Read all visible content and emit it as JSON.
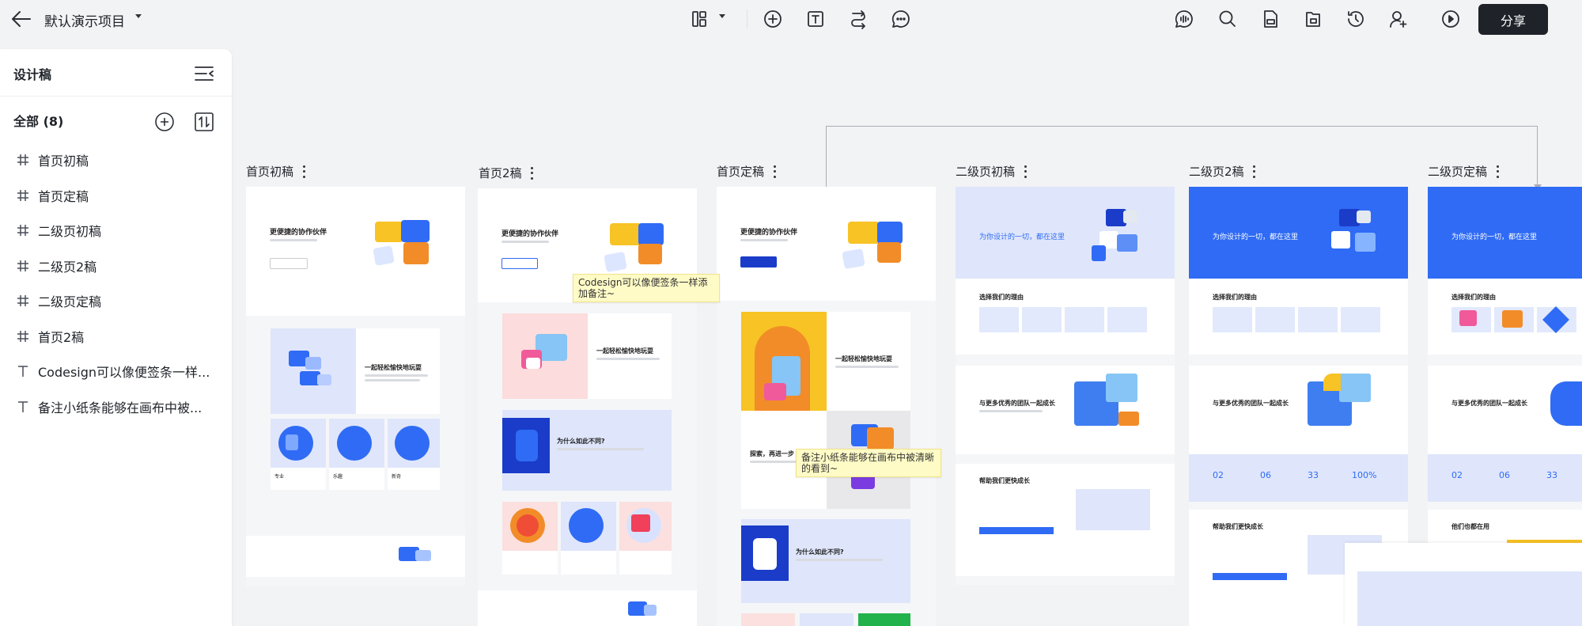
{
  "project": {
    "title": "默认演示项目"
  },
  "toolbar": {
    "share_label": "分享"
  },
  "sidebar": {
    "title": "设计稿",
    "section_label": "全部 (8)",
    "items": [
      {
        "type": "frame",
        "label": "首页初稿"
      },
      {
        "type": "frame",
        "label": "首页定稿"
      },
      {
        "type": "frame",
        "label": "二级页初稿"
      },
      {
        "type": "frame",
        "label": "二级页2稿"
      },
      {
        "type": "frame",
        "label": "二级页定稿"
      },
      {
        "type": "frame",
        "label": "首页2稿"
      },
      {
        "type": "text",
        "label": "Codesign可以像便签条一样..."
      },
      {
        "type": "text",
        "label": "备注小纸条能够在画布中被..."
      }
    ]
  },
  "canvas": {
    "frames": [
      {
        "label": "首页初稿"
      },
      {
        "label": "首页2稿"
      },
      {
        "label": "首页定稿"
      },
      {
        "label": "二级页初稿"
      },
      {
        "label": "二级页2稿"
      },
      {
        "label": "二级页定稿"
      }
    ],
    "notes": [
      "Codesign可以像便签条一样添加备注~",
      "备注小纸条能够在画布中被清晰的看到~"
    ],
    "frame_text": {
      "hero": "更便捷的协作伙伴",
      "hero_sub": "一起轻松愉快地玩耍",
      "why_diff": "为什么如此不同?",
      "explore": "探索，再进一步",
      "blue_hero": "为你设计的一切，都在这里",
      "choose": "选择我们的理由",
      "grow": "与更多优秀的团队一起成长",
      "help": "帮助我们更快成长",
      "used": "他们也都在用",
      "stats": [
        "02",
        "06",
        "33",
        "100%"
      ],
      "pro": "专业",
      "fun": "乐趣",
      "new": "新奇"
    }
  },
  "colors": {
    "accent_blue": "#2f6bf5",
    "share_bg": "#1f2329",
    "sticky": "#fffbc6",
    "yellow": "#f7c325",
    "orange": "#f28c28"
  }
}
